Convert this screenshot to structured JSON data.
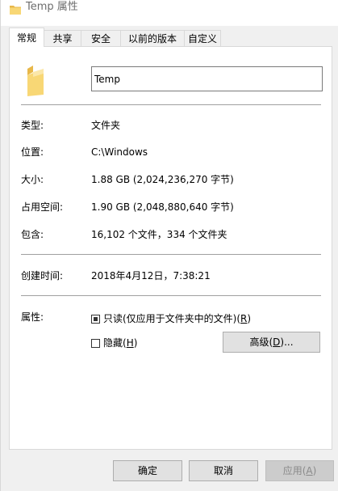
{
  "window": {
    "title": "Temp 属性"
  },
  "tabs": [
    {
      "label": "常规",
      "active": true
    },
    {
      "label": "共享",
      "active": false
    },
    {
      "label": "安全",
      "active": false
    },
    {
      "label": "以前的版本",
      "active": false
    },
    {
      "label": "自定义",
      "active": false
    }
  ],
  "general": {
    "name_value": "Temp",
    "type_label": "类型:",
    "type_value": "文件夹",
    "location_label": "位置:",
    "location_value": "C:\\Windows",
    "size_label": "大小:",
    "size_value": "1.88 GB (2,024,236,270 字节)",
    "disk_size_label": "占用空间:",
    "disk_size_value": "1.90 GB (2,048,880,640 字节)",
    "contains_label": "包含:",
    "contains_value": "16,102 个文件，334 个文件夹",
    "created_label": "创建时间:",
    "created_value": "2018年4月12日，7:38:21",
    "attributes_label": "属性:",
    "readonly_text": "只读(仅应用于文件夹中的文件)(",
    "readonly_key": "R",
    "readonly_close": ")",
    "hidden_text": "隐藏(",
    "hidden_key": "H",
    "hidden_close": ")",
    "advanced_text": "高级(",
    "advanced_key": "D",
    "advanced_close": ")..."
  },
  "buttons": {
    "ok": "确定",
    "cancel": "取消",
    "apply_text": "应用(",
    "apply_key": "A",
    "apply_close": ")"
  },
  "colors": {
    "folder": "#f8d775",
    "folder_dark": "#e8b84a"
  }
}
